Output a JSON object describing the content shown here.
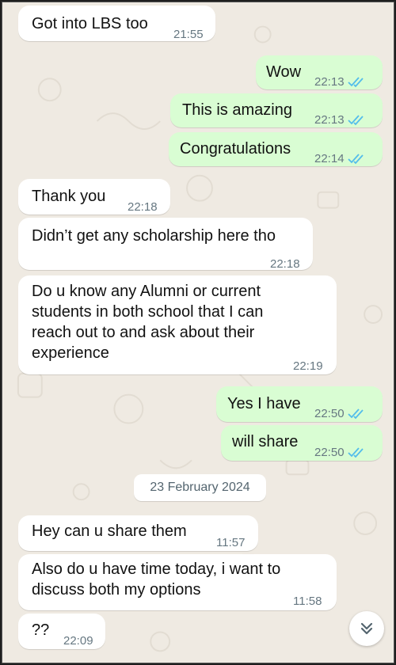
{
  "messages": [
    {
      "text": "Got into LBS too",
      "time": "21:55"
    },
    {
      "text": "Wow",
      "time": "22:13"
    },
    {
      "text": "This is amazing",
      "time": "22:13"
    },
    {
      "text": "Congratulations",
      "time": "22:14"
    },
    {
      "text": "Thank you",
      "time": "22:18"
    },
    {
      "text": "Didn’t get any scholarship here tho",
      "time": "22:18"
    },
    {
      "text": "Do u know any Alumni or current\nstudents in both school that I can\nreach out to and ask about their\nexperience",
      "time": "22:19"
    },
    {
      "text": "Yes I have",
      "time": "22:50"
    },
    {
      "text": "will share",
      "time": "22:50"
    },
    {
      "text": "Hey can u share them",
      "time": "11:57"
    },
    {
      "text": "Also do u have time today, i want to\ndiscuss both my options",
      "time": "11:58"
    },
    {
      "text": "??",
      "time": "22:09"
    }
  ],
  "date_separator": "23 February 2024",
  "colors": {
    "chat_background": "#efeae2",
    "incoming_bubble": "#ffffff",
    "outgoing_bubble": "#d9fdd3",
    "read_tick": "#53bdeb",
    "timestamp": "#667781"
  },
  "icons": {
    "read_receipt": "double-check-icon",
    "scroll_down": "double-chevron-down-icon"
  }
}
